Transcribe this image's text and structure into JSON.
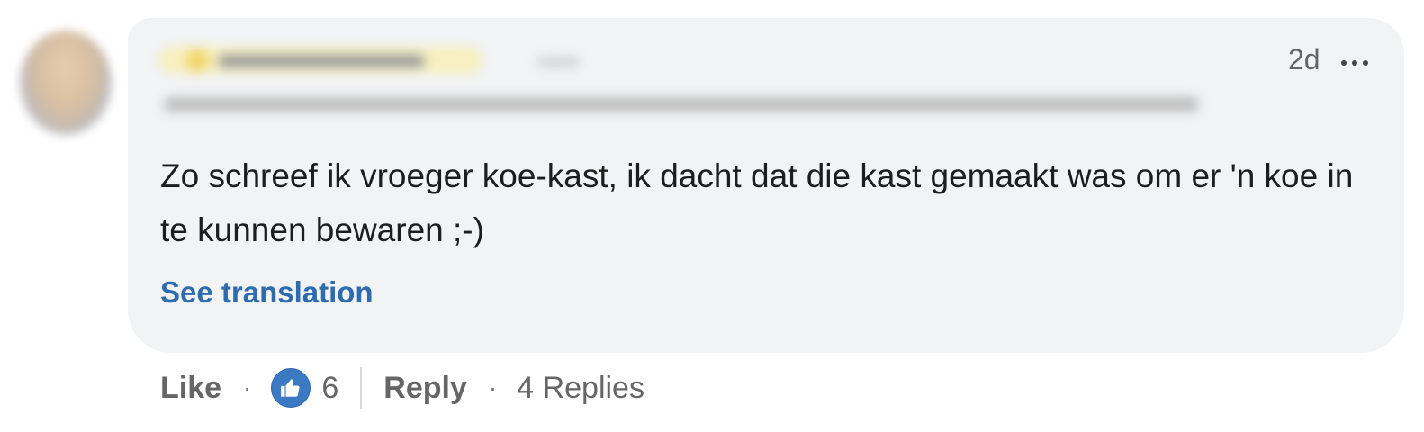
{
  "comment": {
    "time": "2d",
    "text": "Zo schreef ik vroeger koe-kast, ik dacht dat die kast gemaakt was om er 'n koe in te kunnen bewaren ;-)",
    "see_translation": "See translation"
  },
  "actions": {
    "like_label": "Like",
    "separator": "·",
    "like_count": "6",
    "reply_label": "Reply",
    "replies_label": "4 Replies"
  },
  "icons": {
    "more": "more-horizontal-icon",
    "reaction": "thumbs-up-icon"
  },
  "colors": {
    "bubble": "#f2f3f5",
    "link": "#2e6cad",
    "reaction": "#3b7ac2"
  }
}
